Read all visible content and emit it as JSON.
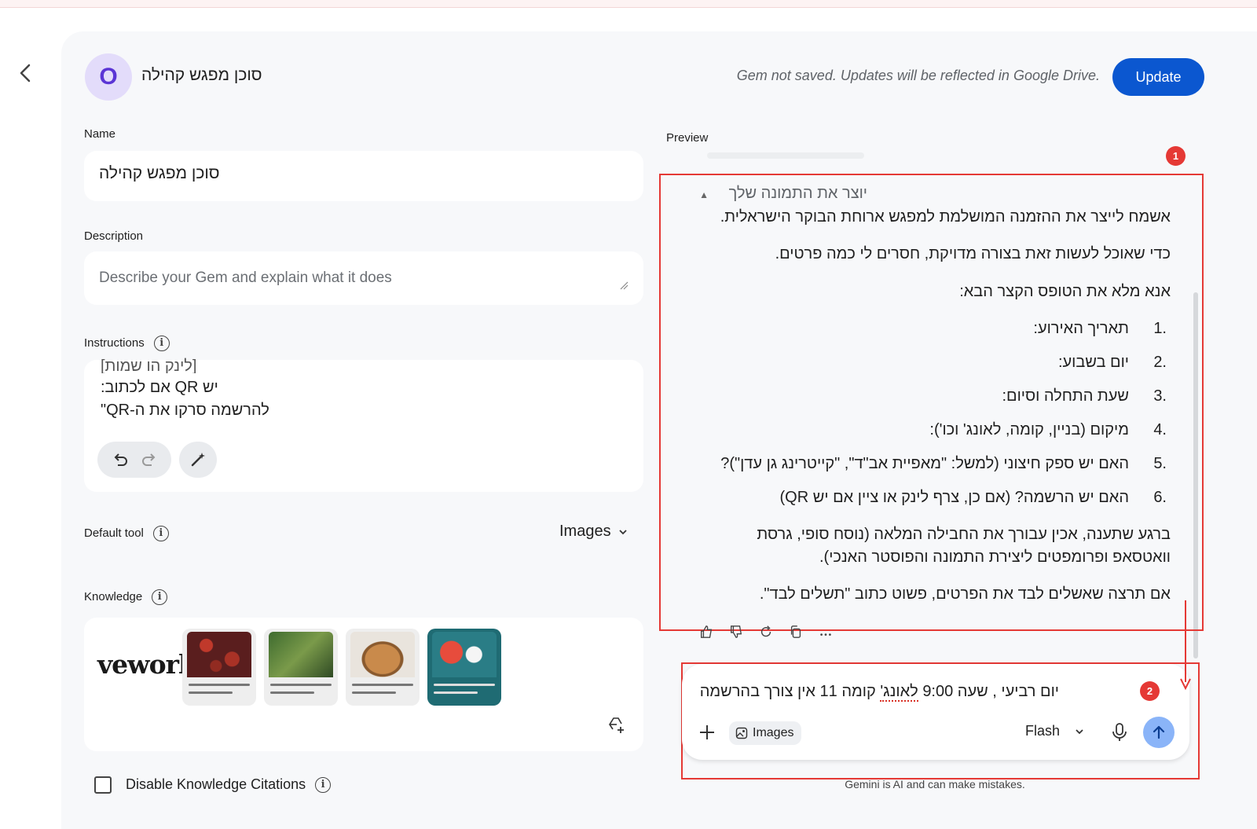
{
  "header": {
    "back_label": "Back",
    "avatar_letter": "O",
    "gem_title": "סוכן מפגש קהילה",
    "save_note": "Gem not saved. Updates will be reflected in Google Drive.",
    "update_label": "Update"
  },
  "form": {
    "name_label": "Name",
    "name_value": "סוכן מפגש קהילה",
    "description_label": "Description",
    "description_placeholder": "Describe your Gem and explain what it does",
    "instructions_label": "Instructions",
    "instruction_lines": [
      "[לינק הו שמות]",
      "יש QR אם לכתוב:",
      "להרשמה סרקו את ה-QR\""
    ],
    "default_tool_label": "Default tool",
    "default_tool_value": "Images",
    "knowledge_label": "Knowledge",
    "knowledge_logo_text": "veworl",
    "disable_citations_label": "Disable Knowledge Citations"
  },
  "preview": {
    "label": "Preview",
    "creating_image": "יוצר את התמונה שלך",
    "paragraph_1": "אשמח לייצר את ההזמנה המושלמת למפגש ארוחת הבוקר הישראלית.",
    "paragraph_2": "כדי שאוכל לעשות זאת בצורה מדויקת, חסרים לי כמה פרטים.",
    "paragraph_3": "אנא מלא את הטופס הקצר הבא:",
    "list": [
      {
        "num": "1.",
        "text": "תאריך האירוע:"
      },
      {
        "num": "2.",
        "text": "יום בשבוע:"
      },
      {
        "num": "3.",
        "text": "שעת התחלה וסיום:"
      },
      {
        "num": "4.",
        "text": "מיקום (בניין, קומה, לאונג' וכו'):"
      },
      {
        "num": "5.",
        "text": "האם יש ספק חיצוני (למשל: \"מאפיית אב\"ד\", \"קייטרינג גן עדן\")?"
      },
      {
        "num": "6.",
        "text": "האם יש הרשמה? (אם כן, צרף לינק או ציין אם יש QR)"
      }
    ],
    "paragraph_4a": "ברגע שתענה, אכין עבורך את החבילה המלאה (נוסח סופי, גרסת",
    "paragraph_4b": "וואטסאפ ופרומפטים ליצירת התמונה והפוסטר האנכי).",
    "paragraph_5": "אם תרצה שאשלים לבד את הפרטים, פשוט כתוב \"תשלים לבד\".",
    "badge_1": "1",
    "badge_2": "2"
  },
  "composer": {
    "input_text_part1": "יום רביעי , שעה 9:00 ",
    "input_text_underlined": "לאונג'",
    "input_text_part2": " קומה 11 אין צורך בהרשמה",
    "tool_chip": "Images",
    "model": "Flash",
    "disclaimer": "Gemini is AI and can make mistakes."
  },
  "colors": {
    "accent": "#0b57d0",
    "annotation_red": "#e53935",
    "send_button": "#8ab4f8",
    "avatar_bg": "#e3dcfa"
  }
}
